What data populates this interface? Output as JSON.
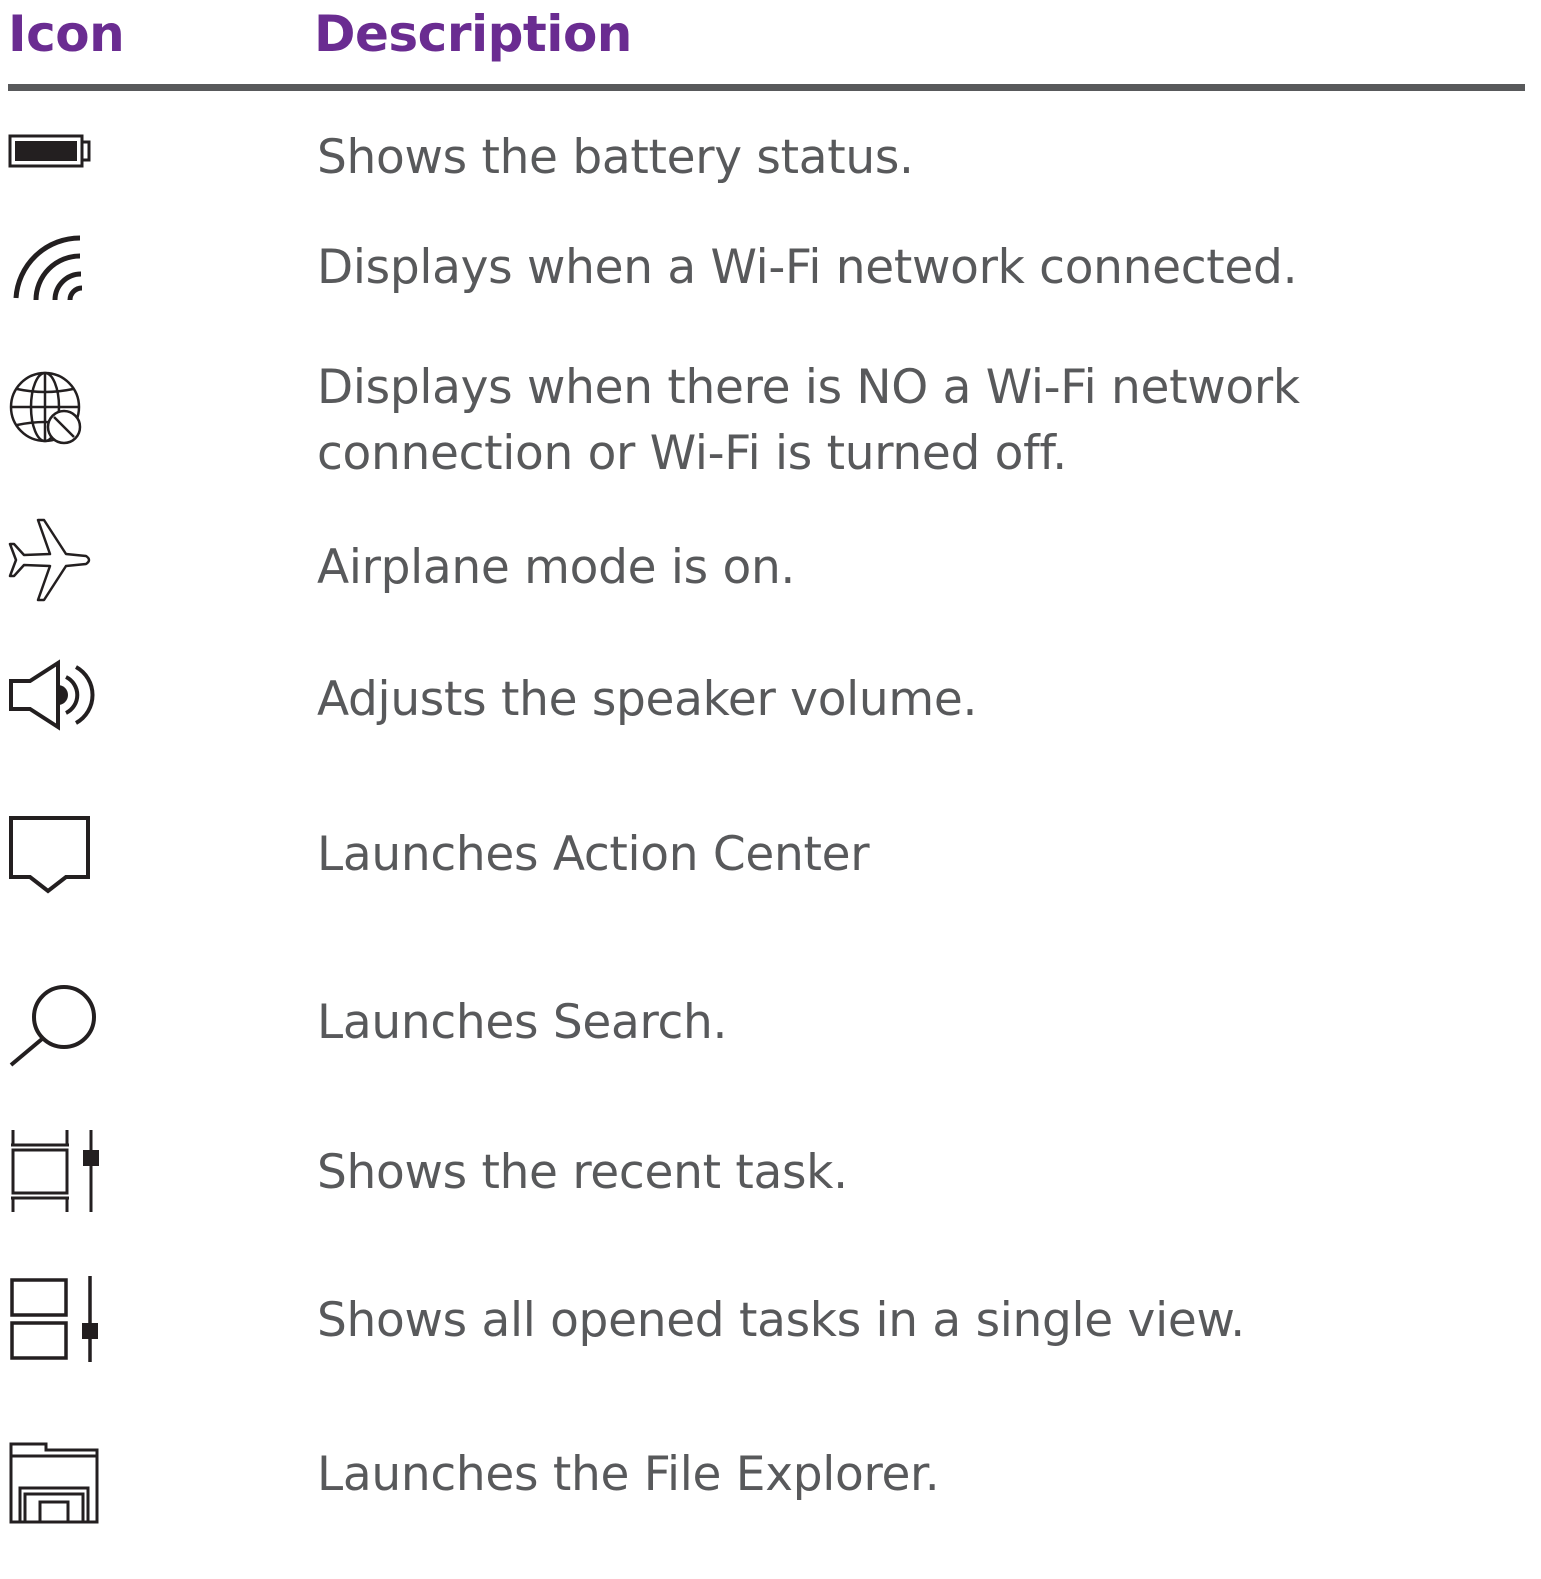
{
  "header": {
    "icon_label": "Icon",
    "description_label": "Description"
  },
  "colors": {
    "header_text": "#6a2c91",
    "rule": "#58595b",
    "body_text": "#58595b",
    "icon_stroke": "#231f20"
  },
  "rows": [
    {
      "icon": "battery-icon",
      "description": [
        "Shows the battery status."
      ]
    },
    {
      "icon": "wifi-icon",
      "description": [
        "Displays when a Wi-Fi network connected."
      ]
    },
    {
      "icon": "globe-no-network-icon",
      "description": [
        "Displays when there is NO a Wi-Fi network",
        "connection or Wi-Fi is turned off."
      ]
    },
    {
      "icon": "airplane-icon",
      "description": [
        "Airplane mode is on."
      ]
    },
    {
      "icon": "speaker-icon",
      "description": [
        "Adjusts the speaker volume."
      ]
    },
    {
      "icon": "action-center-icon",
      "description": [
        "Launches Action Center"
      ]
    },
    {
      "icon": "search-icon",
      "description": [
        "Launches Search."
      ]
    },
    {
      "icon": "recent-task-icon",
      "description": [
        "Shows the recent task."
      ]
    },
    {
      "icon": "task-view-icon",
      "description": [
        "Shows all opened tasks in a single view."
      ]
    },
    {
      "icon": "file-explorer-icon",
      "description": [
        "Launches the File Explorer."
      ]
    }
  ]
}
